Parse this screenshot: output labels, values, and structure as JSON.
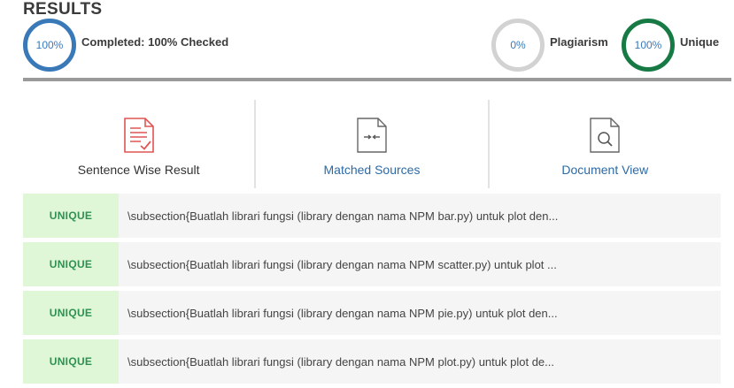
{
  "header": {
    "title": "RESULTS",
    "completed": {
      "percent": "100%",
      "label": "Completed: 100% Checked"
    },
    "plagiarism": {
      "percent": "0%",
      "label": "Plagiarism"
    },
    "unique": {
      "percent": "100%",
      "label": "Unique"
    }
  },
  "colors": {
    "completed_ring": "#3a79b8",
    "plagiarism_ring": "#d2d2d2",
    "unique_ring": "#177a45",
    "link": "#2c6aa6",
    "unique_badge_bg": "#e0f7d7",
    "unique_badge_text": "#2e9152"
  },
  "tabs": [
    {
      "label": "Sentence Wise Result",
      "icon": "document-check-icon",
      "active": true
    },
    {
      "label": "Matched Sources",
      "icon": "document-compare-icon",
      "active": false
    },
    {
      "label": "Document View",
      "icon": "document-search-icon",
      "active": false
    }
  ],
  "results": [
    {
      "status": "UNIQUE",
      "text": "\\subsection{Buatlah librari fungsi (library dengan nama NPM bar.py) untuk plot den..."
    },
    {
      "status": "UNIQUE",
      "text": "\\subsection{Buatlah librari fungsi (library dengan nama NPM scatter.py) untuk plot ..."
    },
    {
      "status": "UNIQUE",
      "text": "\\subsection{Buatlah librari fungsi (library dengan nama NPM pie.py) untuk plot den..."
    },
    {
      "status": "UNIQUE",
      "text": "\\subsection{Buatlah librari fungsi (library dengan nama NPM plot.py) untuk plot de..."
    }
  ]
}
